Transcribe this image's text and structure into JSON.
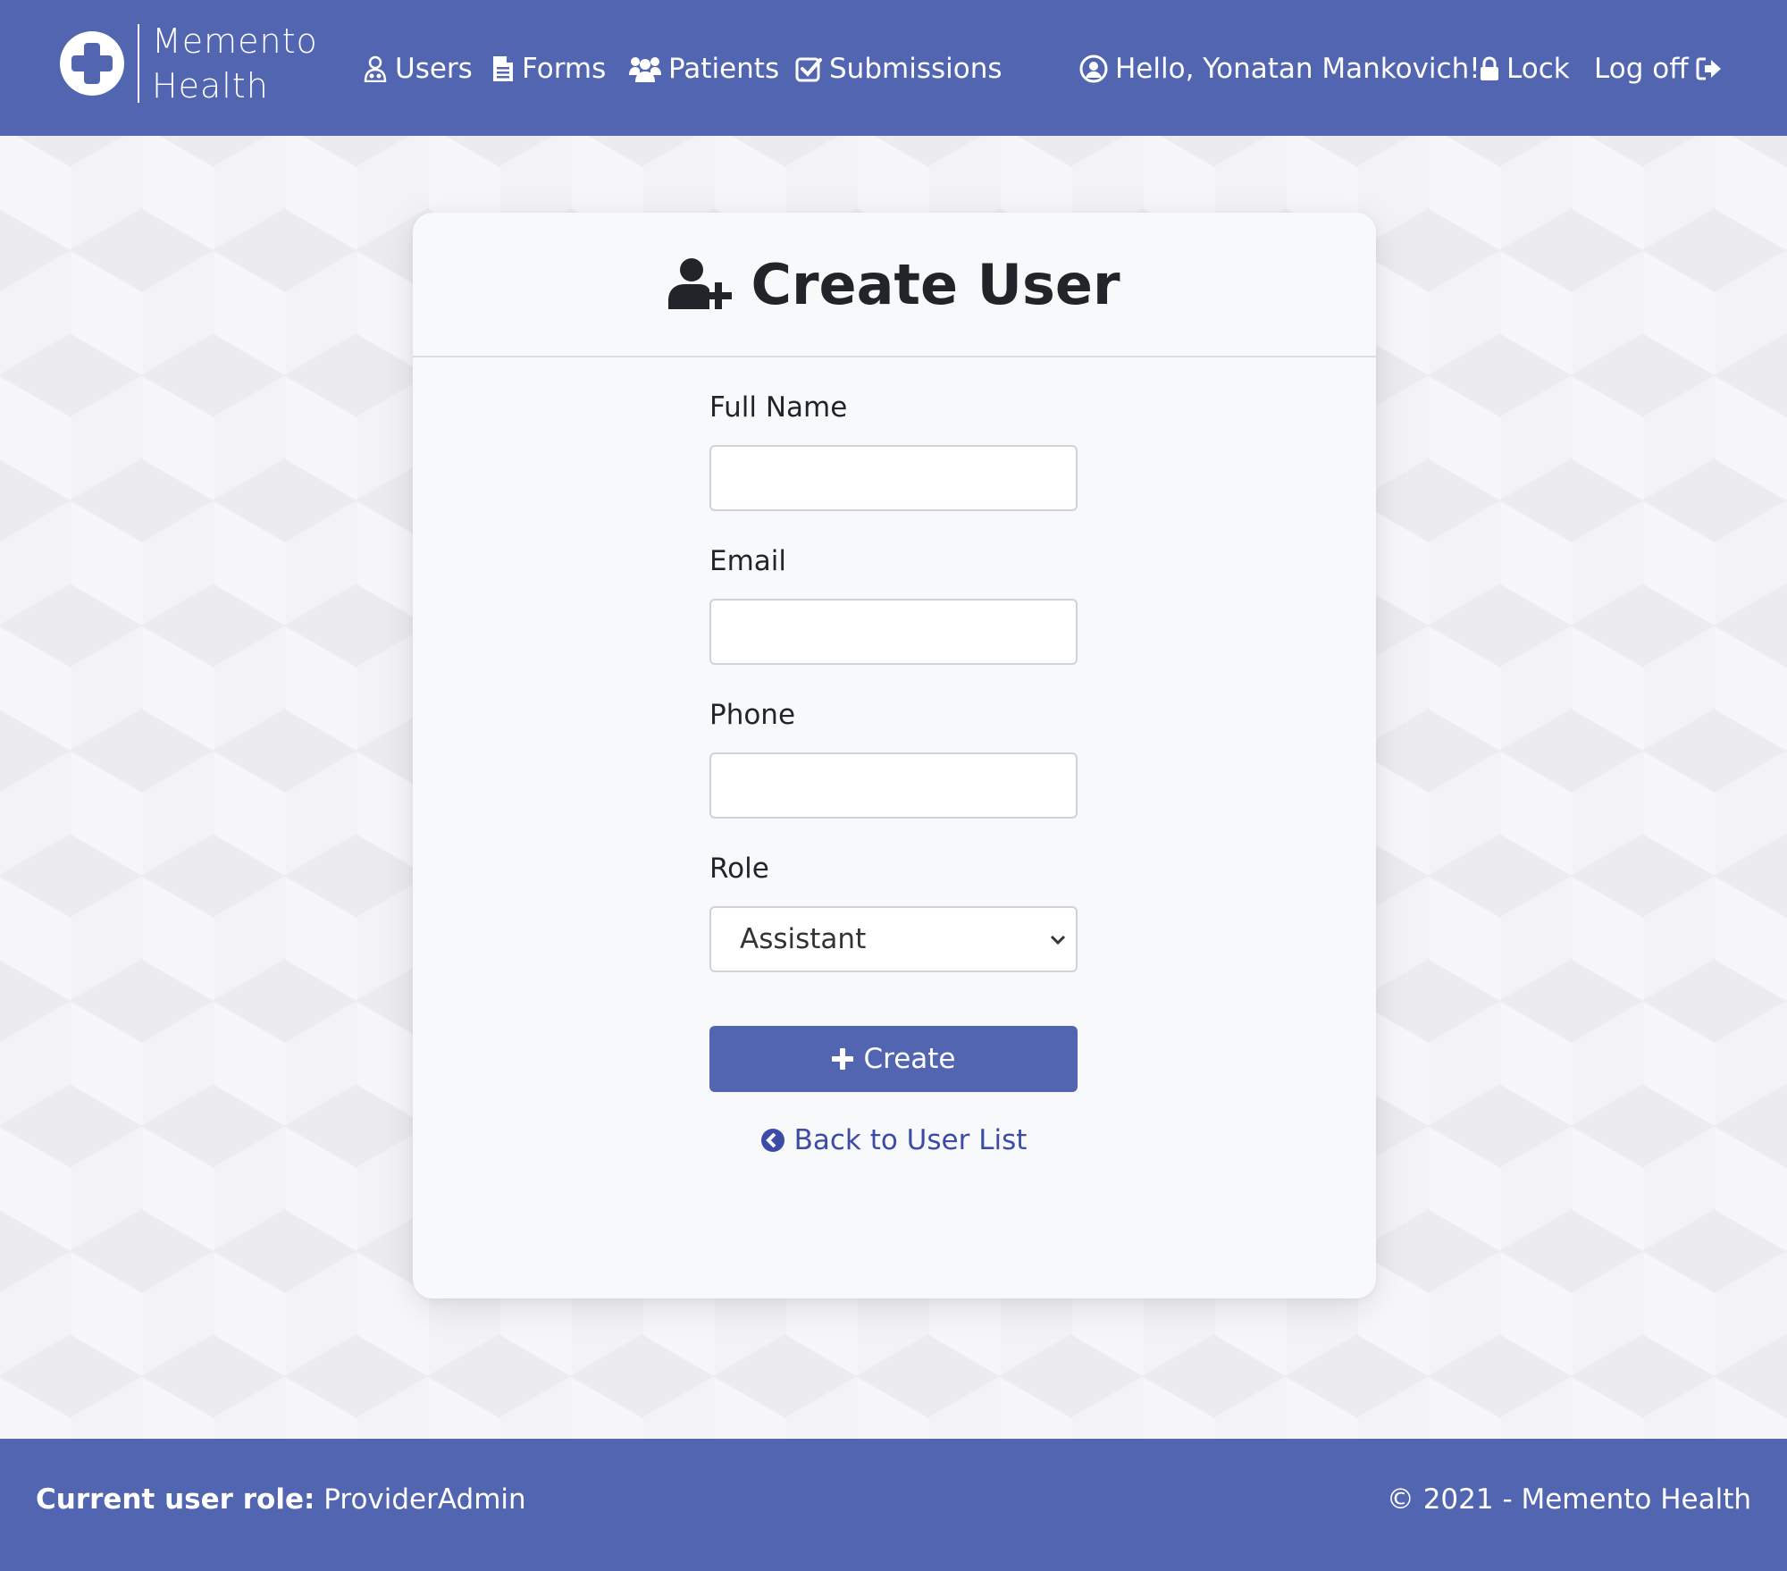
{
  "brand": {
    "line1": "Memento",
    "line2": "Health"
  },
  "nav": {
    "users": "Users",
    "forms": "Forms",
    "patients": "Patients",
    "submissions": "Submissions",
    "greeting": "Hello, Yonatan Mankovich!",
    "lock": "Lock",
    "logoff": "Log off"
  },
  "page": {
    "title": "Create User"
  },
  "form": {
    "full_name_label": "Full Name",
    "full_name_value": "",
    "email_label": "Email",
    "email_value": "",
    "phone_label": "Phone",
    "phone_value": "",
    "role_label": "Role",
    "role_selected": "Assistant",
    "create_label": "Create",
    "back_label": "Back to User List"
  },
  "footer": {
    "role_label": "Current user role:",
    "role_value": "ProviderAdmin",
    "copyright": "© 2021 - Memento Health"
  },
  "colors": {
    "primary": "#5265b0",
    "link": "#3b4ba6",
    "card": "#f8f9fb"
  },
  "icons": [
    "medical-cross-icon",
    "user-nurse-icon",
    "file-icon",
    "users-icon",
    "check-square-icon",
    "user-circle-icon",
    "lock-icon",
    "sign-out-icon",
    "user-plus-icon",
    "chevron-down-icon",
    "plus-icon",
    "chevron-circle-left-icon"
  ]
}
